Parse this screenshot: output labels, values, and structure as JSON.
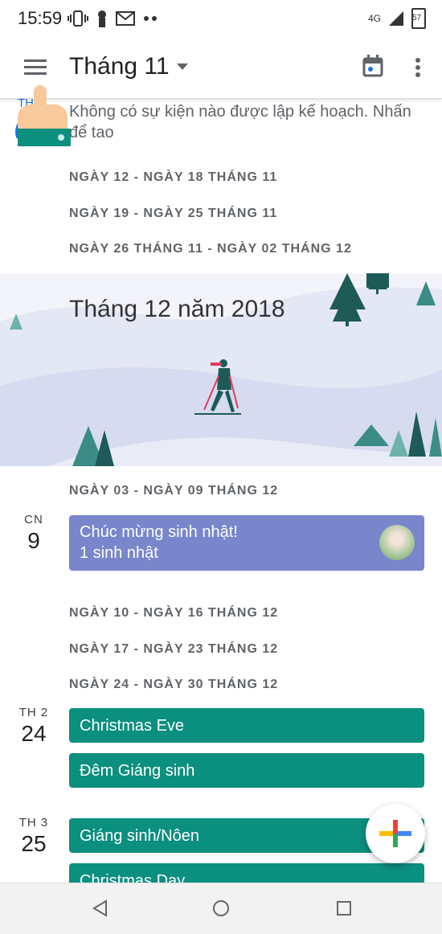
{
  "status_bar": {
    "time": "15:59",
    "network": "4G",
    "battery": "57"
  },
  "app_bar": {
    "month_title": "Tháng 11"
  },
  "top_event": {
    "day_label": "TH",
    "text_line1": "Không có sự kiện nào được lập kế hoạch. Nhấn",
    "text_line2": "để tạo"
  },
  "weeks_nov": [
    "NGÀY 12 - NGÀY 18 THÁNG 11",
    "NGÀY 19 - NGÀY 25 THÁNG 11",
    "NGÀY 26 THÁNG 11 - NGÀY 02 THÁNG 12"
  ],
  "banner": {
    "month_title": "Tháng 12 năm 2018"
  },
  "week_dec_1": "NGÀY 03 - NGÀY 09 THÁNG 12",
  "day_9": {
    "dow": "CN",
    "num": "9",
    "event_title": "Chúc mừng sinh nhật!",
    "event_sub": "1 sinh nhật",
    "color": "#7986cb"
  },
  "weeks_dec": [
    "NGÀY 10 - NGÀY 16 THÁNG 12",
    "NGÀY 17 - NGÀY 23 THÁNG 12",
    "NGÀY 24 - NGÀY 30 THÁNG 12"
  ],
  "day_24": {
    "dow": "TH 2",
    "num": "24",
    "events": [
      "Christmas Eve",
      "Đêm Giáng sinh"
    ]
  },
  "day_25": {
    "dow": "TH 3",
    "num": "25",
    "events": [
      "Giáng sinh/Nôen",
      "Christmas Day"
    ]
  },
  "colors": {
    "event_green": "#0b8f7f",
    "event_purple": "#7986cb",
    "accent_blue": "#1a73e8"
  }
}
